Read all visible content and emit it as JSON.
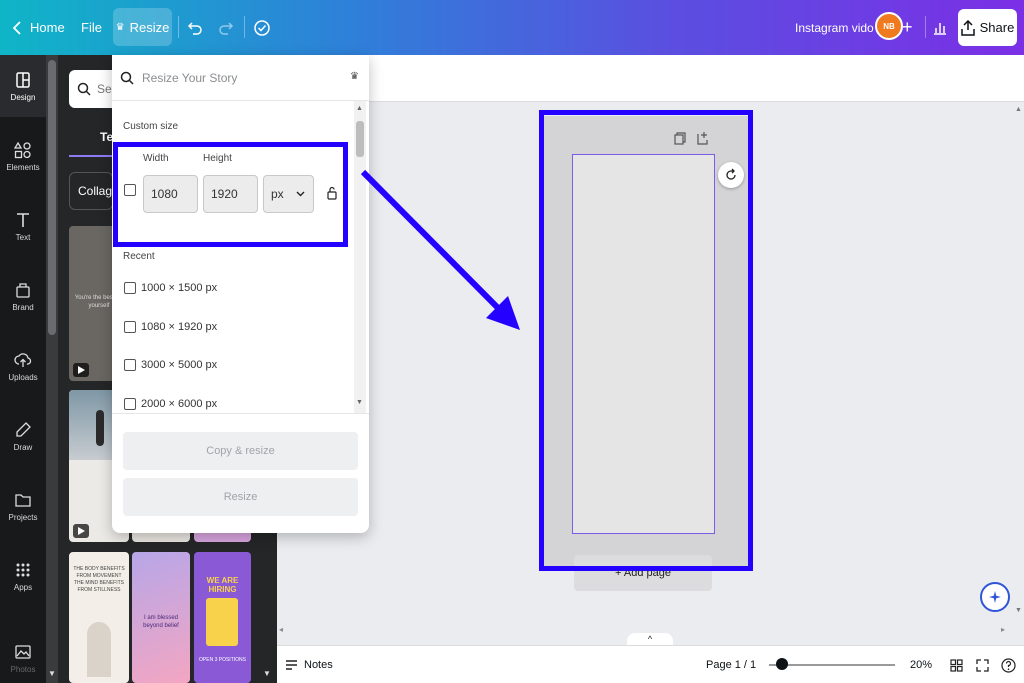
{
  "topbar": {
    "home": "Home",
    "file": "File",
    "resize": "Resize",
    "design_title": "Instagram vido",
    "avatar_initials": "NB",
    "share": "Share"
  },
  "rail": [
    {
      "label": "Design",
      "icon": "layout-icon"
    },
    {
      "label": "Elements",
      "icon": "shapes-icon"
    },
    {
      "label": "Text",
      "icon": "text-icon"
    },
    {
      "label": "Brand",
      "icon": "brand-icon"
    },
    {
      "label": "Uploads",
      "icon": "cloud-upload-icon"
    },
    {
      "label": "Draw",
      "icon": "pen-icon"
    },
    {
      "label": "Projects",
      "icon": "folder-icon"
    },
    {
      "label": "Apps",
      "icon": "apps-grid-icon"
    },
    {
      "label": "Photos",
      "icon": "image-icon"
    }
  ],
  "panel": {
    "search_placeholder": "Sear",
    "tab": "Te",
    "filter": "Collage",
    "thumb1_text": "You're the best for yourself",
    "thumb3_title": "THE BODY BENEFITS FROM MOVEMENT THE MIND BENEFITS FROM STILLNESS",
    "thumb4_text": "I am blessed beyond belief",
    "thumb5_title": "WE ARE HIRING",
    "thumb5_sub": "OPEN 3 POSITIONS"
  },
  "dropdown": {
    "search_placeholder": "Resize Your Story",
    "custom_size": "Custom size",
    "width_label": "Width",
    "height_label": "Height",
    "width_value": "1080",
    "height_value": "1920",
    "unit": "px",
    "recent_label": "Recent",
    "recent": [
      "1000 × 1500 px",
      "1080 × 1920 px",
      "3000 × 5000 px",
      "2000 × 6000 px"
    ],
    "copy_resize": "Copy & resize",
    "resize": "Resize"
  },
  "canvas": {
    "add_page": "+ Add page",
    "collapse": "^"
  },
  "bottombar": {
    "notes": "Notes",
    "page": "Page 1 / 1",
    "zoom": "20%",
    "zoom_fraction": 0.2
  },
  "colors": {
    "highlight": "#2300ff",
    "accent": "#7d5ce8"
  }
}
